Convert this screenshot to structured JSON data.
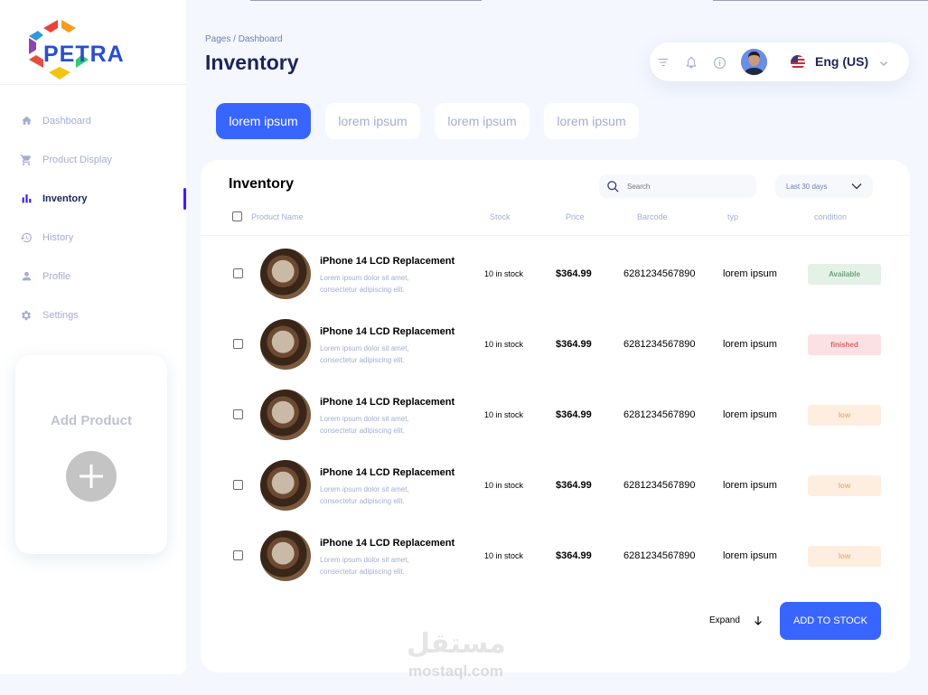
{
  "brand": {
    "name": "PETRA"
  },
  "sidebar": {
    "items": [
      {
        "label": "Dashboard",
        "icon": "home-icon",
        "active": false
      },
      {
        "label": "Product Display",
        "icon": "cart-icon",
        "active": false
      },
      {
        "label": "Inventory",
        "icon": "bar-chart-icon",
        "active": true
      },
      {
        "label": "History",
        "icon": "history-icon",
        "active": false
      },
      {
        "label": "Profile",
        "icon": "person-icon",
        "active": false
      },
      {
        "label": "Settings",
        "icon": "gear-icon",
        "active": false
      }
    ],
    "add_card": {
      "title": "Add Product"
    }
  },
  "header": {
    "breadcrumb": "Pages / Dashboard",
    "title": "Inventory",
    "language": "Eng (US)"
  },
  "tabs": [
    {
      "label": "lorem ipsum",
      "active": true
    },
    {
      "label": "lorem ipsum",
      "active": false
    },
    {
      "label": "lorem ipsum",
      "active": false
    },
    {
      "label": "lorem ipsum",
      "active": false
    }
  ],
  "card": {
    "title": "Inventory",
    "search_placeholder": "Search",
    "date_filter": "Last 30 days",
    "columns": [
      "Product Name",
      "Stock",
      "Price",
      "Barcode",
      "typ",
      "condition"
    ],
    "rows": [
      {
        "name": "iPhone 14 LCD Replacement",
        "desc1": "Lorem ipsum dolor sit amet,",
        "desc2": "consectetur adipiscing elit.",
        "stock": "10 in stock",
        "price": "$364.99",
        "barcode": "6281234567890",
        "typ": "lorem ipsum",
        "condition": "Available"
      },
      {
        "name": "iPhone 14 LCD Replacement",
        "desc1": "Lorem ipsum dolor sit amet,",
        "desc2": "consectetur adipiscing elit.",
        "stock": "10 in stock",
        "price": "$364.99",
        "barcode": "6281234567890",
        "typ": "lorem ipsum",
        "condition": "finished"
      },
      {
        "name": "iPhone 14 LCD Replacement",
        "desc1": "Lorem ipsum dolor sit amet,",
        "desc2": "consectetur adipiscing elit.",
        "stock": "10 in stock",
        "price": "$364.99",
        "barcode": "6281234567890",
        "typ": "lorem ipsum",
        "condition": "low"
      },
      {
        "name": "iPhone 14 LCD Replacement",
        "desc1": "Lorem ipsum dolor sit amet,",
        "desc2": "consectetur adipiscing elit.",
        "stock": "10 in stock",
        "price": "$364.99",
        "barcode": "6281234567890",
        "typ": "lorem ipsum",
        "condition": "low"
      },
      {
        "name": "iPhone 14 LCD Replacement",
        "desc1": "Lorem ipsum dolor sit amet,",
        "desc2": "consectetur adipiscing elit.",
        "stock": "10 in stock",
        "price": "$364.99",
        "barcode": "6281234567890",
        "typ": "lorem ipsum",
        "condition": "low"
      }
    ],
    "expand_label": "Expand",
    "add_button": "ADD TO STOCK"
  },
  "status_colors": {
    "Available": {
      "bg": "#e3f1e6",
      "fg": "#6aa37a"
    },
    "finished": {
      "bg": "#fbe1e3",
      "fg": "#d4656d"
    },
    "low": {
      "bg": "#fdeee0",
      "fg": "#f0b07a"
    }
  },
  "colors": {
    "accent": "#3965ff",
    "nav_active_bar": "#4318ff"
  },
  "watermark": {
    "arabic": "مستقل",
    "latin": "mostaql.com"
  }
}
